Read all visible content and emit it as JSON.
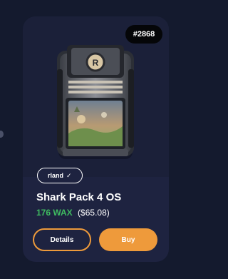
{
  "card": {
    "badge": "#2868",
    "creator": "rland",
    "creator_verified": true,
    "title": "Shark Pack 4 OS",
    "price_wax": "176 WAX",
    "price_usd": "($65.08)",
    "details_label": "Details",
    "buy_label": "Buy"
  },
  "colors": {
    "background": "#141a2e",
    "card": "#1e2340",
    "accent": "#ee9a3b",
    "wax_price": "#3fb960"
  }
}
